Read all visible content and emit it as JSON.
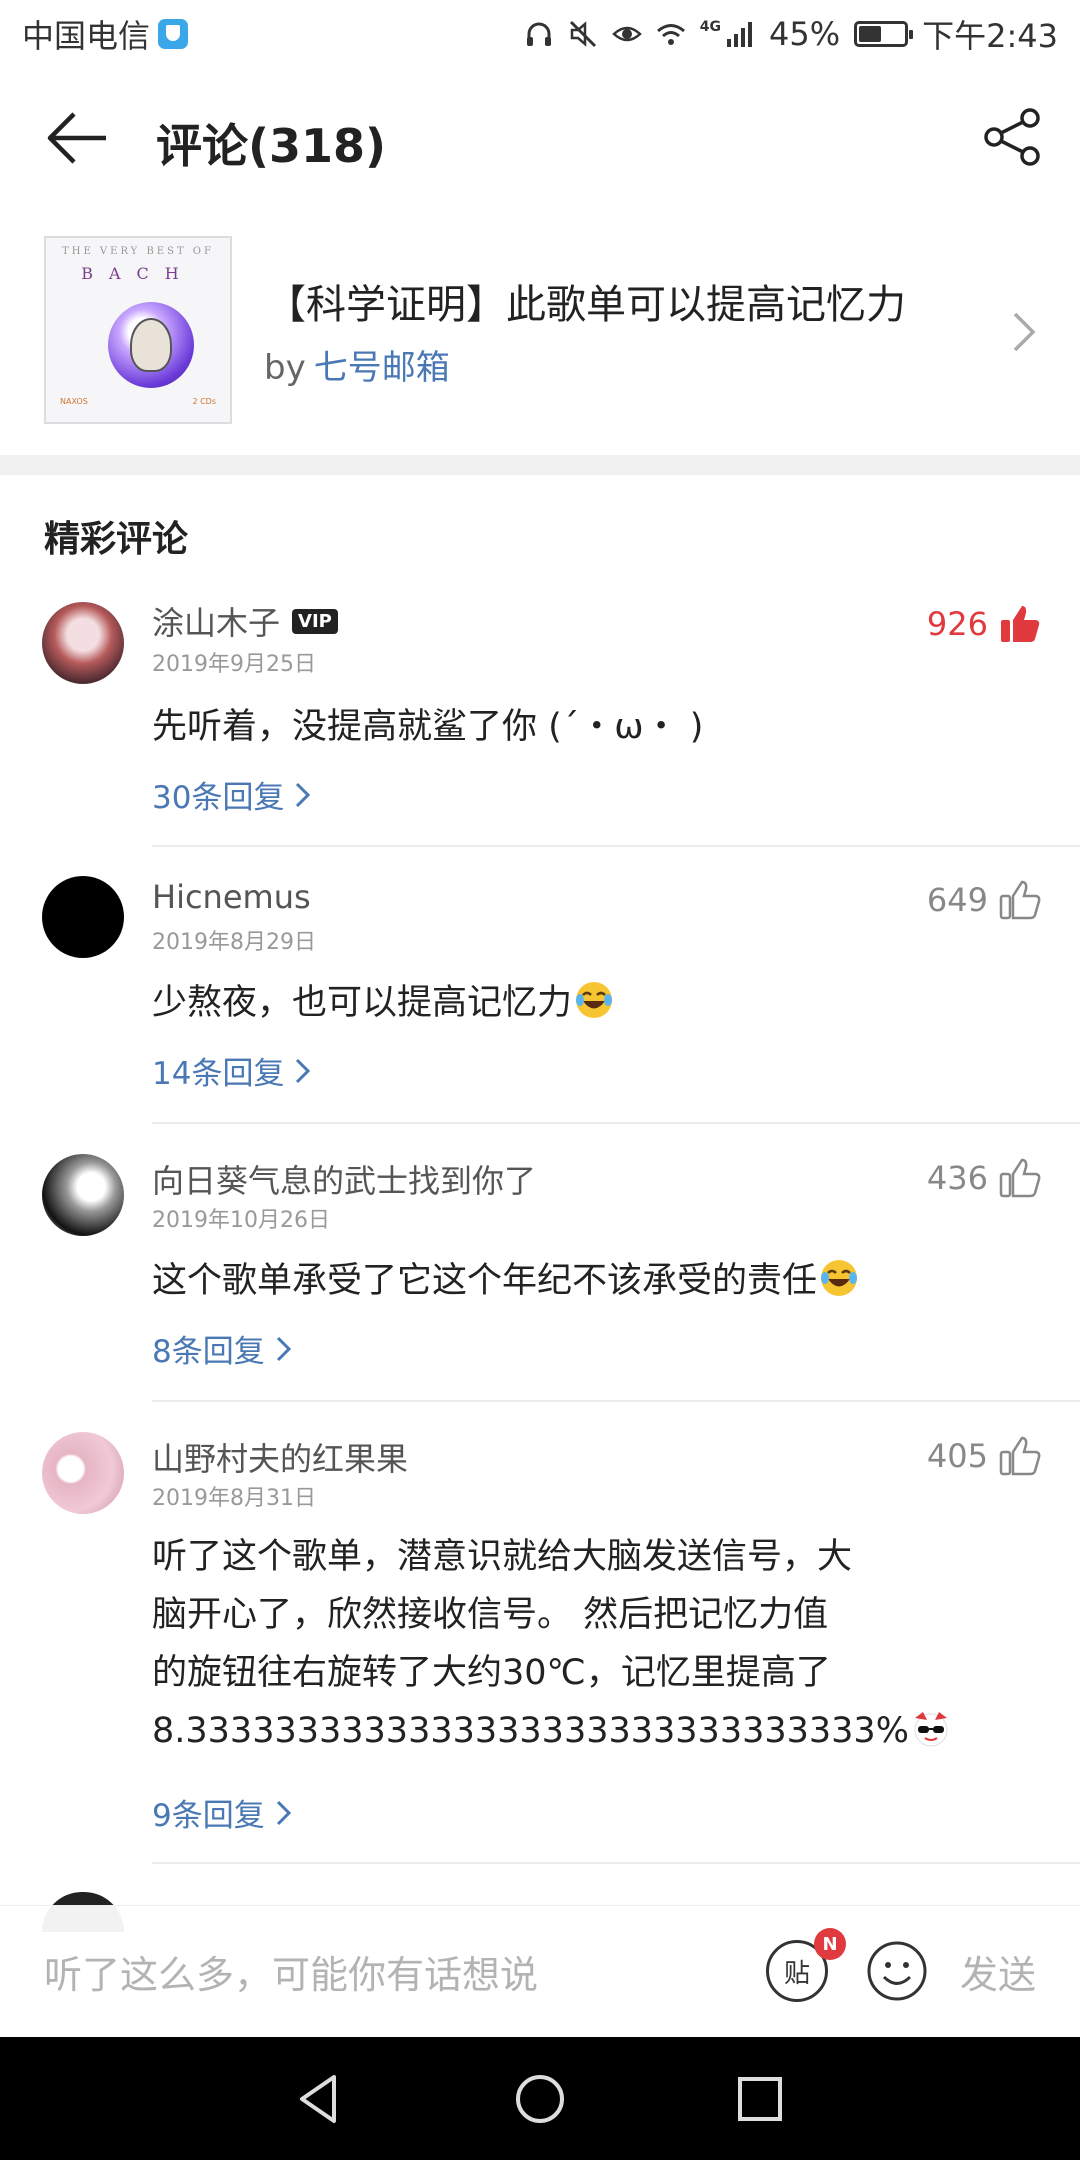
{
  "status_bar": {
    "carrier": "中国电信",
    "signal": "4G",
    "battery_percent": "45%",
    "battery_level": 0.45,
    "time": "下午2:43"
  },
  "header": {
    "title": "评论(318)"
  },
  "playlist": {
    "cover": {
      "top_text": "THE VERY BEST OF",
      "artist": "BACH",
      "tag_left": "NAXOS",
      "tag_right": "2 CDs"
    },
    "name": "【科学证明】此歌单可以提高记忆力",
    "by": "by",
    "author": "七号邮箱"
  },
  "section_title": "精彩评论",
  "comments": [
    {
      "user": "涂山木子",
      "vip": "VIP",
      "date": "2019年9月25日",
      "likes": "926",
      "text": "先听着，没提高就鲨了你 (´・ω・ )",
      "replies": "30条回复"
    },
    {
      "user": "Hicnemus",
      "date": "2019年8月29日",
      "likes": "649",
      "text": "少熬夜，也可以提高记忆力",
      "replies": "14条回复"
    },
    {
      "user": "向日葵气息的武士找到你了",
      "date": "2019年10月26日",
      "likes": "436",
      "text": "这个歌单承受了它这个年纪不该承受的责任",
      "replies": "8条回复"
    },
    {
      "user": "山野村夫的红果果",
      "date": "2019年8月31日",
      "likes": "405",
      "text_lines": [
        "听了这个歌单，潜意识就给大脑发送信号，大",
        "脑开心了，欣然接收信号。 然后把记忆力值",
        "的旋钮往右旋转了大约30℃，记忆里提高了",
        "8.3333333333333333333333333333333%"
      ],
      "replies": "9条回复"
    }
  ],
  "input_bar": {
    "placeholder": "听了这么多，可能你有话想说",
    "sticker_label": "贴",
    "badge": "N",
    "send": "发送"
  },
  "colors": {
    "accent_blue": "#4a78b5",
    "like_red": "#e0393e"
  }
}
